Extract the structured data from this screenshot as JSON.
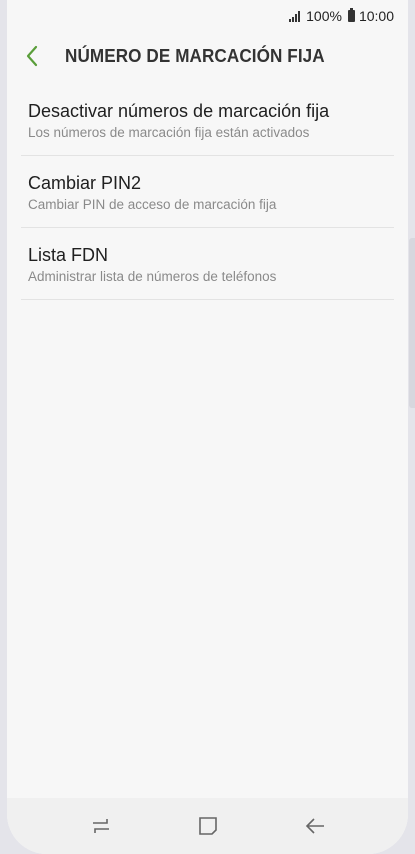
{
  "status_bar": {
    "battery_percent": "100%",
    "time": "10:00"
  },
  "header": {
    "title": "NÚMERO DE MARCACIÓN FIJA",
    "back_icon": "chevron-left-icon",
    "accent_color": "#5a9e3a"
  },
  "items": [
    {
      "title": "Desactivar números de marcación fija",
      "subtitle": "Los números de marcación fija están activados"
    },
    {
      "title": "Cambiar PIN2",
      "subtitle": "Cambiar PIN de acceso de marcación fija"
    },
    {
      "title": "Lista FDN",
      "subtitle": "Administrar lista de números de teléfonos"
    }
  ],
  "navbar": {
    "recents_icon": "recents-icon",
    "home_icon": "home-icon",
    "back_icon": "back-arrow-icon"
  }
}
